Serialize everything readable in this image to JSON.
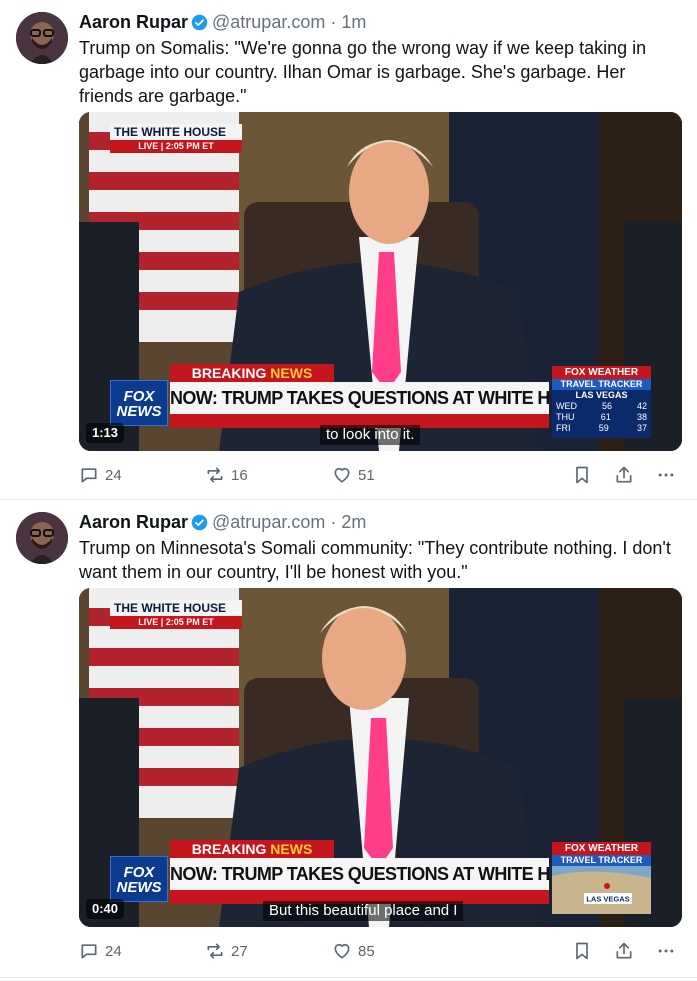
{
  "posts": [
    {
      "author": {
        "name": "Aaron Rupar",
        "handle": "@atrupar.com",
        "time": "1m"
      },
      "text": "Trump on Somalis: \"We're gonna go the wrong way if we keep taking in garbage into our country. Ilhan Omar is garbage. She's garbage. Her friends are garbage.\"",
      "video": {
        "timestamp": "1:13",
        "caption": "to look into it.",
        "chyron": {
          "network_tag": "THE WHITE HOUSE",
          "live": "LIVE | 2:05 PM ET",
          "breaking": "BREAKING",
          "breaking_news": "NEWS",
          "headline": "NOW: TRUMP TAKES QUESTIONS AT WHITE HOUSE",
          "logo_line1": "FOX",
          "logo_line2": "NEWS"
        },
        "weather": {
          "brand": "FOX WEATHER",
          "title": "TRAVEL TRACKER",
          "city": "LAS VEGAS",
          "rows": [
            {
              "day": "WED",
              "hi": "56",
              "lo": "42"
            },
            {
              "day": "THU",
              "hi": "61",
              "lo": "38"
            },
            {
              "day": "FRI",
              "hi": "59",
              "lo": "37"
            }
          ]
        }
      },
      "stats": {
        "replies": "24",
        "reposts": "16",
        "likes": "51"
      }
    },
    {
      "author": {
        "name": "Aaron Rupar",
        "handle": "@atrupar.com",
        "time": "2m"
      },
      "text": "Trump on Minnesota's Somali community: \"They contribute nothing. I don't want them in our country, I'll be honest with you.\"",
      "video": {
        "timestamp": "0:40",
        "caption": "But this beautiful place and I",
        "chyron": {
          "network_tag": "THE WHITE HOUSE",
          "live": "LIVE | 2:05 PM ET",
          "breaking": "BREAKING",
          "breaking_news": "NEWS",
          "headline": "NOW: TRUMP TAKES QUESTIONS AT WHITE HOUSE",
          "logo_line1": "FOX",
          "logo_line2": "NEWS"
        },
        "weather": {
          "brand": "FOX WEATHER",
          "title": "TRAVEL TRACKER",
          "city": "LAS VEGAS"
        }
      },
      "stats": {
        "replies": "24",
        "reposts": "27",
        "likes": "85"
      }
    }
  ],
  "colors": {
    "verified": "#1d9bf0",
    "text": "#0f1419",
    "muted": "#66717c",
    "icon": "#5b6670"
  },
  "icons": [
    "verified-badge-icon",
    "reply-icon",
    "repost-icon",
    "like-icon",
    "bookmark-icon",
    "share-icon",
    "more-icon"
  ]
}
